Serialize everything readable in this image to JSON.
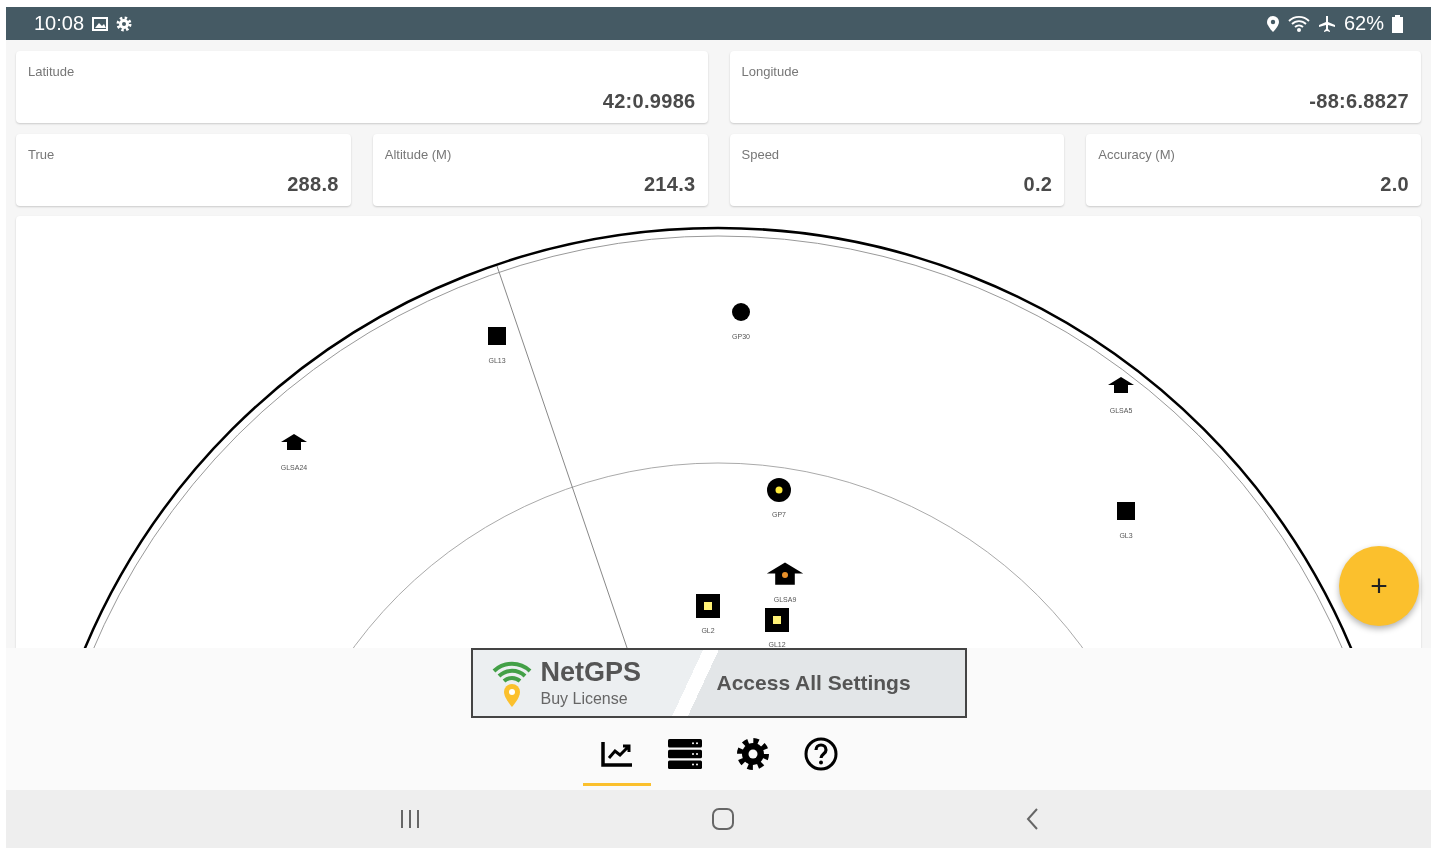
{
  "status_bar": {
    "time": "10:08",
    "battery": "62%"
  },
  "position_fields": [
    {
      "label": "Latitude",
      "value": "42:0.9986"
    },
    {
      "label": "Longitude",
      "value": "-88:6.8827"
    }
  ],
  "motion_fields": [
    {
      "label": "True",
      "value": "288.8"
    },
    {
      "label": "Altitude (M)",
      "value": "214.3"
    },
    {
      "label": "Speed",
      "value": "0.2"
    },
    {
      "label": "Accuracy (M)",
      "value": "2.0"
    }
  ],
  "sky_plot": {
    "satellites": [
      {
        "label": "GP30",
        "kind": "circle",
        "used": false
      },
      {
        "label": "GL13",
        "kind": "square",
        "used": false
      },
      {
        "label": "GLSA24",
        "kind": "house",
        "used": false
      },
      {
        "label": "GLSA5",
        "kind": "house",
        "used": false
      },
      {
        "label": "GP7",
        "kind": "circle",
        "used": true
      },
      {
        "label": "GL3",
        "kind": "square",
        "used": false
      },
      {
        "label": "GLSA9",
        "kind": "house",
        "used": true
      },
      {
        "label": "GL2",
        "kind": "square",
        "used": true
      },
      {
        "label": "GL12",
        "kind": "square",
        "used": true
      }
    ]
  },
  "fab": {
    "label": "+"
  },
  "banner": {
    "brand": "NetGPS",
    "subtitle": "Buy License",
    "action": "Access All Settings"
  },
  "tabs": [
    {
      "kind": "chart",
      "selected": true
    },
    {
      "kind": "list",
      "selected": false
    },
    {
      "kind": "settings",
      "selected": false
    },
    {
      "kind": "help",
      "selected": false
    }
  ]
}
